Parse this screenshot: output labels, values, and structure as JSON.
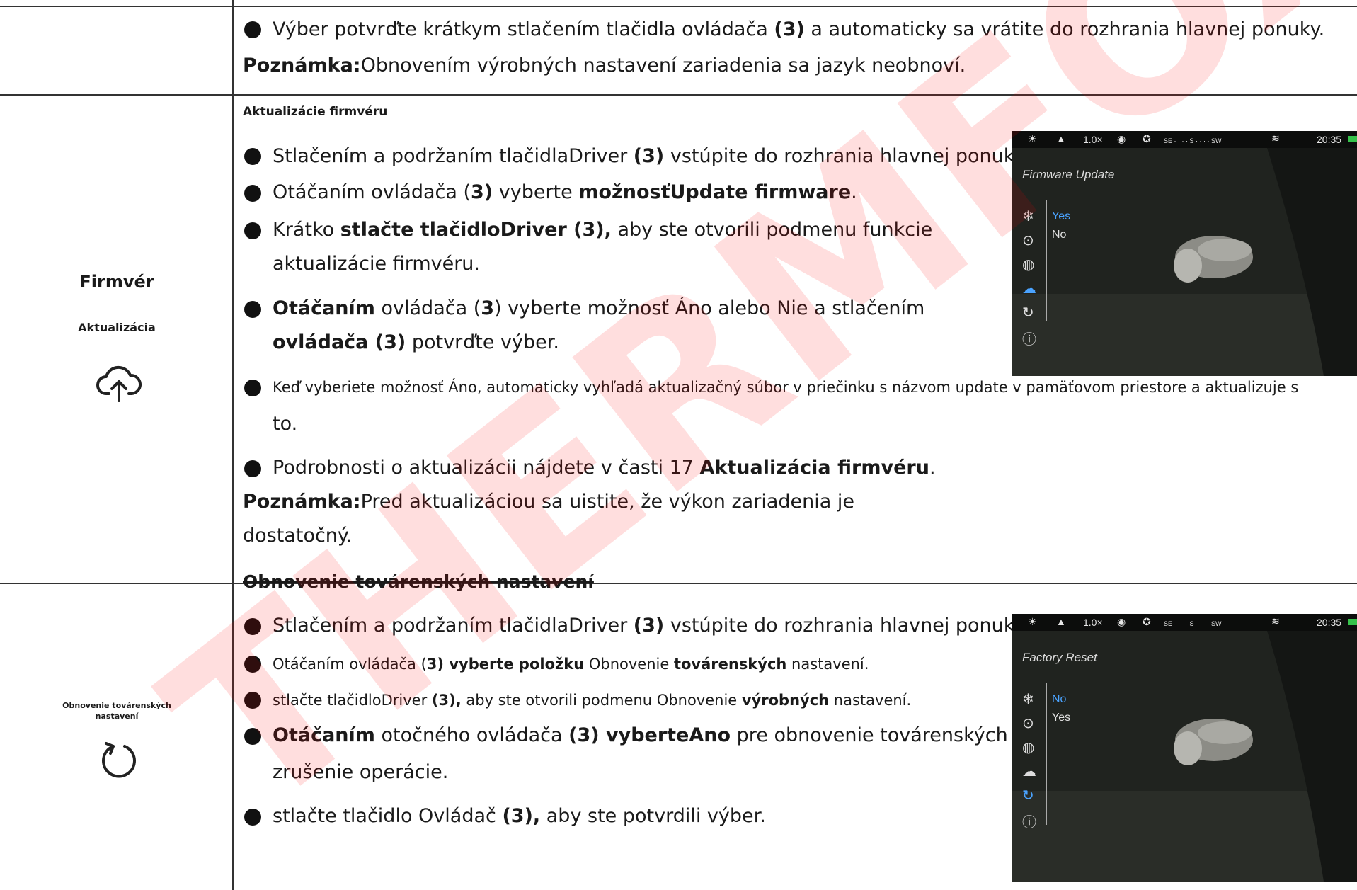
{
  "watermark": "THERMFOX",
  "top_row": {
    "bullet1_pre": "Výber potvrďte krátkym stlačením tlačidla ovládača ",
    "bullet1_b": "(3)",
    "bullet1_post": " a automaticky sa vrátite do rozhrania hlavnej ponuky.",
    "note_label": "Poznámka:",
    "note_text": "Obnovením výrobných nastavení zariadenia sa jazyk neobnoví."
  },
  "firmware": {
    "label_title": "Firmvér",
    "label_sub": "Aktualizácia",
    "icon": "cloud-upload-icon",
    "heading": "Aktualizácie firmvéru",
    "b1_pre": "Stlačením a podržaním tlačidlaDriver ",
    "b1_b": "(3)",
    "b1_post": " vstúpite do rozhrania hlavnej ponuky.",
    "b2_pre": "Otáčaním ovládača (",
    "b2_b1": "3)",
    "b2_mid": " vyberte ",
    "b2_b2": "možnosťUpdate firmware",
    "b2_post": ".",
    "b3_pre": "Krátko ",
    "b3_b": "stlačte tlačidloDriver (3),",
    "b3_post": " aby ste otvorili podmenu funkcie",
    "b3_line2": "aktualizácie firmvéru.",
    "b4_b1": "Otáčaním",
    "b4_mid": " ovládača (",
    "b4_b2": "3",
    "b4_post": ") vyberte možnosť Áno alebo Nie a stlačením",
    "b4_line2_b": "ovládača (3)",
    "b4_line2_post": " potvrďte výber.",
    "b5": "Keď vyberiete možnosť Áno, automaticky vyhľadá aktualizačný súbor v priečinku s názvom update v pamäťovom priestore a aktualizuje s",
    "b5_line2": "to.",
    "b6_pre": "Podrobnosti o aktualizácii nájdete v časti 17 ",
    "b6_b": "Aktualizácia firmvéru",
    "b6_post": ".",
    "note_label": "Poznámka:",
    "note_text": "Pred aktualizáciou sa uistite, že výkon zariadenia je",
    "note_line2": "dostatočný."
  },
  "reset": {
    "label_title": "Obnovenie továrenských",
    "label_sub": "nastavení",
    "icon": "refresh-icon",
    "heading": "Obnovenie továrenských nastavení",
    "b1_pre": "Stlačením a podržaním tlačidlaDriver ",
    "b1_b": "(3)",
    "b1_post": " vstúpite do rozhrania hlavnej ponuky.",
    "b2_pre": "Otáčaním ovládača (",
    "b2_b1": "3) vyberte položku",
    "b2_mid": " Obnovenie ",
    "b2_b2": "továrenských",
    "b2_post": " nastavení.",
    "b3_pre": "stlačte tlačidloDriver ",
    "b3_b1": "(3),",
    "b3_mid": " aby ste otvorili podmenu Obnovenie ",
    "b3_b2": "výrobných",
    "b3_post": " nastavení.",
    "b4_b1": "Otáčaním",
    "b4_mid": " otočného ovládača ",
    "b4_b2": "(3) vyberteAno",
    "b4_post": " pre obnovenie továrenských nastavení aleboNie pre",
    "b4_line2": "zrušenie operácie.",
    "b5_pre": "stlačte tlačidlo Ovládač ",
    "b5_b": "(3),",
    "b5_post": " aby ste potvrdili výber."
  },
  "screen1": {
    "status_zoom": "1.0×",
    "compass": "SE · · · · S · · · · SW",
    "time": "20:35",
    "title": "Firmware Update",
    "opt_selected": "Yes",
    "opt_other": "No"
  },
  "screen2": {
    "status_zoom": "1.0×",
    "compass": "SE · · · · S · · · · SW",
    "time": "20:35",
    "title": "Factory Reset",
    "opt_selected": "No",
    "opt_other": "Yes"
  }
}
